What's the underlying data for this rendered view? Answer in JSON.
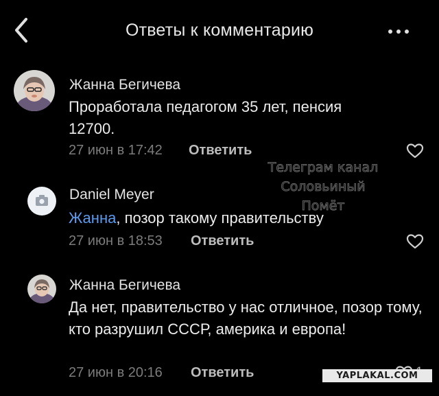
{
  "header": {
    "title": "Ответы к комментарию",
    "back_icon": "chevron-left-icon",
    "more_icon": "more-horizontal-icon"
  },
  "comments": [
    {
      "author": "Жанна Бегичева",
      "text": "Проработала педагогом 35 лет, пенсия 12700.",
      "timestamp": "27 июн в 17:42",
      "reply_label": "Ответить",
      "avatar": "profile-photo"
    },
    {
      "author": "Daniel Meyer",
      "mention": "Жанна",
      "text": ", позор такому правительству",
      "timestamp": "27 июн в 18:53",
      "reply_label": "Ответить",
      "avatar": "camera-placeholder-icon"
    },
    {
      "author": "Жанна Бегичева",
      "text": "Да нет, правительство у нас отличное, позор тому, кто разрушил СССР, америка и европа!",
      "timestamp": "27 июн в 20:16",
      "reply_label": "Ответить",
      "like_count": "1",
      "avatar": "profile-photo"
    }
  ],
  "watermark": {
    "line1": "Телеграм канал",
    "line2": "Соловьиный Помёт"
  },
  "site_badge": "YAPLAKAL.COM",
  "colors": {
    "background": "#000000",
    "text": "#ececec",
    "meta": "#7c7c7c",
    "mention": "#5b9bf0"
  }
}
